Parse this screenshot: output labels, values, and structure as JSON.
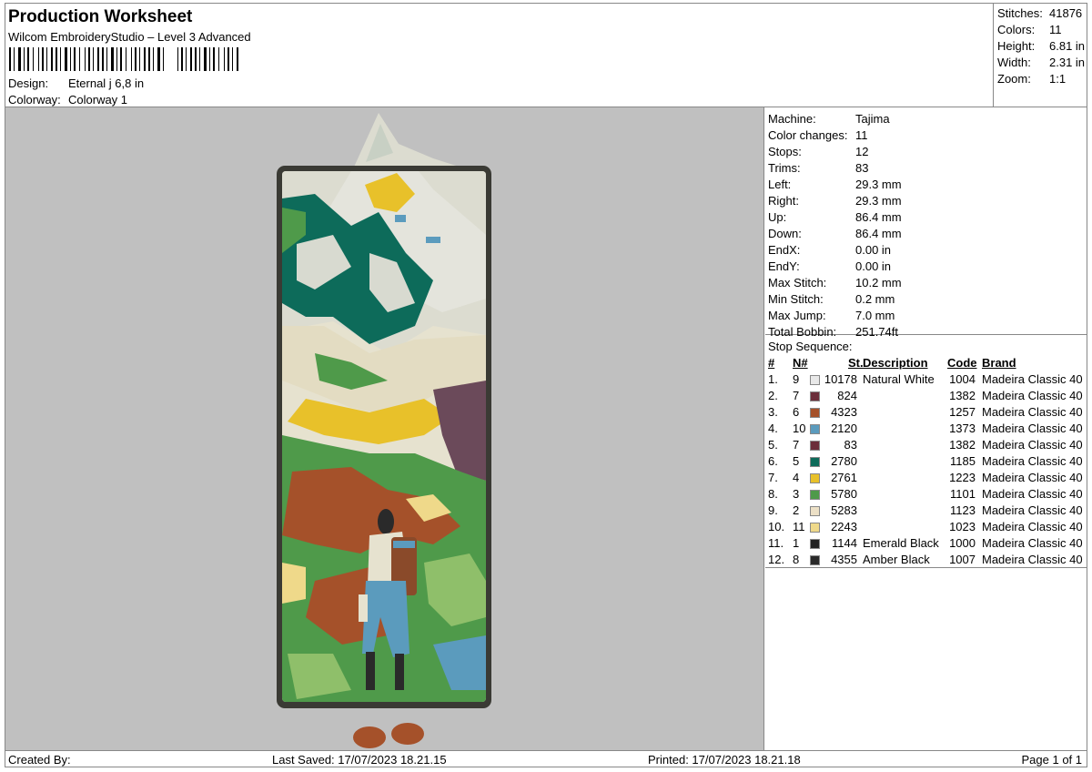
{
  "header": {
    "title": "Production Worksheet",
    "subtitle": "Wilcom EmbroideryStudio – Level 3 Advanced",
    "design_label": "Design:",
    "design_value": "Eternal j 6,8 in",
    "colorway_label": "Colorway:",
    "colorway_value": "Colorway 1"
  },
  "stats": [
    {
      "label": "Stitches:",
      "value": "41876"
    },
    {
      "label": "Colors:",
      "value": "11"
    },
    {
      "label": "Height:",
      "value": "6.81 in"
    },
    {
      "label": "Width:",
      "value": "2.31 in"
    },
    {
      "label": "Zoom:",
      "value": "1:1"
    }
  ],
  "machine_info": [
    {
      "label": "Machine:",
      "value": "Tajima"
    },
    {
      "label": "Color changes:",
      "value": "11"
    },
    {
      "label": "Stops:",
      "value": "12"
    },
    {
      "label": "Trims:",
      "value": "83"
    },
    {
      "label": "Left:",
      "value": "29.3 mm"
    },
    {
      "label": "Right:",
      "value": "29.3 mm"
    },
    {
      "label": "Up:",
      "value": "86.4 mm"
    },
    {
      "label": "Down:",
      "value": "86.4 mm"
    },
    {
      "label": "EndX:",
      "value": "0.00 in"
    },
    {
      "label": "EndY:",
      "value": "0.00 in"
    },
    {
      "label": "Max Stitch:",
      "value": "10.2 mm"
    },
    {
      "label": "Min Stitch:",
      "value": "0.2 mm"
    },
    {
      "label": "Max Jump:",
      "value": "7.0 mm"
    },
    {
      "label": "Total Bobbin:",
      "value": "251.74ft"
    }
  ],
  "stop_sequence": {
    "title": "Stop Sequence:",
    "headers": {
      "num": "#",
      "n": "N#",
      "st": "St.",
      "description": "Description",
      "code": "Code",
      "brand": "Brand"
    },
    "rows": [
      {
        "num": "1.",
        "n": "9",
        "color": "#e8e8e8",
        "st": "10178",
        "description": "Natural White",
        "code": "1004",
        "brand": "Madeira Classic 40"
      },
      {
        "num": "2.",
        "n": "7",
        "color": "#6b2e3a",
        "st": "824",
        "description": "",
        "code": "1382",
        "brand": "Madeira Classic 40"
      },
      {
        "num": "3.",
        "n": "6",
        "color": "#a5512a",
        "st": "4323",
        "description": "",
        "code": "1257",
        "brand": "Madeira Classic 40"
      },
      {
        "num": "4.",
        "n": "10",
        "color": "#5b9bbd",
        "st": "2120",
        "description": "",
        "code": "1373",
        "brand": "Madeira Classic 40"
      },
      {
        "num": "5.",
        "n": "7",
        "color": "#6b2e3a",
        "st": "83",
        "description": "",
        "code": "1382",
        "brand": "Madeira Classic 40"
      },
      {
        "num": "6.",
        "n": "5",
        "color": "#0d6b5a",
        "st": "2780",
        "description": "",
        "code": "1185",
        "brand": "Madeira Classic 40"
      },
      {
        "num": "7.",
        "n": "4",
        "color": "#e8c12a",
        "st": "2761",
        "description": "",
        "code": "1223",
        "brand": "Madeira Classic 40"
      },
      {
        "num": "8.",
        "n": "3",
        "color": "#4f9a4a",
        "st": "5780",
        "description": "",
        "code": "1101",
        "brand": "Madeira Classic 40"
      },
      {
        "num": "9.",
        "n": "2",
        "color": "#ece0c6",
        "st": "5283",
        "description": "",
        "code": "1123",
        "brand": "Madeira Classic 40"
      },
      {
        "num": "10.",
        "n": "11",
        "color": "#efd98a",
        "st": "2243",
        "description": "",
        "code": "1023",
        "brand": "Madeira Classic 40"
      },
      {
        "num": "11.",
        "n": "1",
        "color": "#222222",
        "st": "1144",
        "description": "Emerald Black",
        "code": "1000",
        "brand": "Madeira Classic 40"
      },
      {
        "num": "12.",
        "n": "8",
        "color": "#2a2a2a",
        "st": "4355",
        "description": "Amber Black",
        "code": "1007",
        "brand": "Madeira Classic 40"
      }
    ]
  },
  "footer": {
    "created_by": "Created By:",
    "last_saved": "Last Saved: 17/07/2023 18.21.15",
    "printed": "Printed: 17/07/2023 18.21.18",
    "page": "Page 1 of 1"
  },
  "colors": {
    "canvas_bg": "#c0c0c0",
    "border_dark": "#3a3a34",
    "bookmark_bg": "#e8e4d2"
  }
}
